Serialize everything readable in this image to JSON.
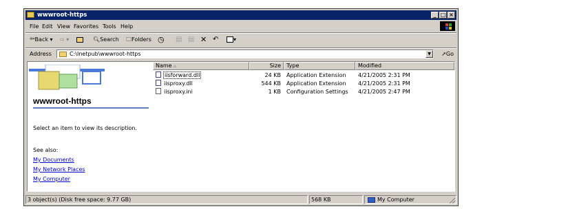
{
  "window": {
    "title": "wwwroot-https"
  },
  "menu": {
    "items": [
      "File",
      "Edit",
      "View",
      "Favorites",
      "Tools",
      "Help"
    ]
  },
  "toolbar": {
    "back_label": "Back",
    "search_label": "Search",
    "folders_label": "Folders"
  },
  "address": {
    "label": "Address",
    "value": "C:\\Inetpub\\wwwroot-https",
    "go_label": "Go"
  },
  "left_pane": {
    "folder_title": "wwwroot-https",
    "description": "Select an item to view its description.",
    "see_also": "See also:",
    "links": [
      "My Documents",
      "My Network Places",
      "My Computer"
    ]
  },
  "columns": {
    "name": "Name",
    "size": "Size",
    "type": "Type",
    "modified": "Modified"
  },
  "files": [
    {
      "name": "iisforward.dll",
      "size": "24 KB",
      "type": "Application Extension",
      "modified": "4/21/2005 2:31 PM"
    },
    {
      "name": "iisproxy.dll",
      "size": "544 KB",
      "type": "Application Extension",
      "modified": "4/21/2005 2:31 PM"
    },
    {
      "name": "iisproxy.ini",
      "size": "1 KB",
      "type": "Configuration Settings",
      "modified": "4/21/2005 2:47 PM"
    }
  ],
  "status": {
    "objects": "3 object(s) (Disk free space: 9.77 GB)",
    "size": "568 KB",
    "location": "My Computer"
  }
}
